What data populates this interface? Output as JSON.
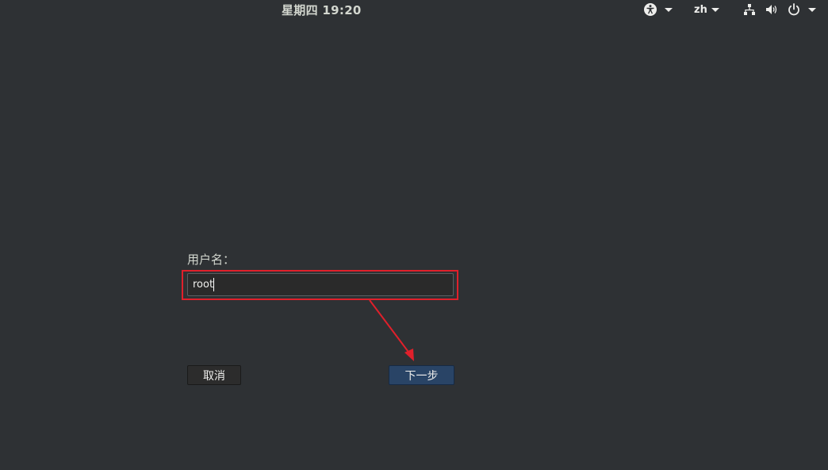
{
  "topbar": {
    "clock": "星期四 19:20",
    "language": "zh"
  },
  "icons": {
    "accessibility": "accessibility-icon",
    "network": "network-icon",
    "volume": "volume-icon",
    "power": "power-icon",
    "dropdown": "chevron-down-icon"
  },
  "login": {
    "username_label": "用户名：",
    "username_value": "root",
    "cancel_label": "取消",
    "next_label": "下一步"
  },
  "colors": {
    "background": "#2e3134",
    "annotation": "#e0202b",
    "primary_button": "#294466"
  }
}
